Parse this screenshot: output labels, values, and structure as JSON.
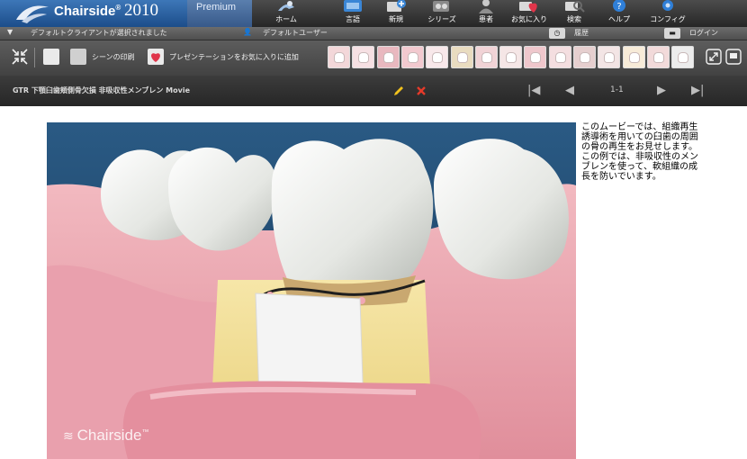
{
  "app": {
    "brand_name": "Chairside",
    "brand_mark": "®",
    "year": "2010",
    "edition": "Premium"
  },
  "nav": [
    {
      "label": "ホーム",
      "icon": "home-icon"
    },
    {
      "label": "言語",
      "icon": "language-icon"
    },
    {
      "label": "新規",
      "icon": "new-icon"
    },
    {
      "label": "シリーズ",
      "icon": "series-icon"
    },
    {
      "label": "患者",
      "icon": "patient-icon"
    },
    {
      "label": "お気に入り",
      "icon": "favorites-icon"
    },
    {
      "label": "検索",
      "icon": "search-icon"
    },
    {
      "label": "ヘルプ",
      "icon": "help-icon"
    },
    {
      "label": "コンフィグ",
      "icon": "config-icon"
    }
  ],
  "status": {
    "client_text": "デフォルトクライアントが選択されました",
    "user_text": "デフォルトユーザー",
    "history_label": "履歴",
    "login_label": "ログイン"
  },
  "toolbar": {
    "print_label": "シーンの印刷",
    "favorite_label": "プレゼンテーションをお気に入りに追加",
    "thumbnail_count": 15
  },
  "player": {
    "title": "GTR 下顎臼歯頬側骨欠損  非吸収性メンブレン  Movie",
    "page": "1-1",
    "watermark": "Chairside",
    "watermark_mark": "™"
  },
  "description": "このムービーでは、組織再生誘導術を用いての臼歯の周囲の骨の再生をお見せします。この例では、非吸収性のメンブレンを使って、軟組織の成長を防いでいます。",
  "colors": {
    "header_blue": "#2b66a8",
    "toolbar_gray": "#4f4f4f",
    "edit_yellow": "#f2c21d",
    "delete_red": "#e53a2a"
  }
}
